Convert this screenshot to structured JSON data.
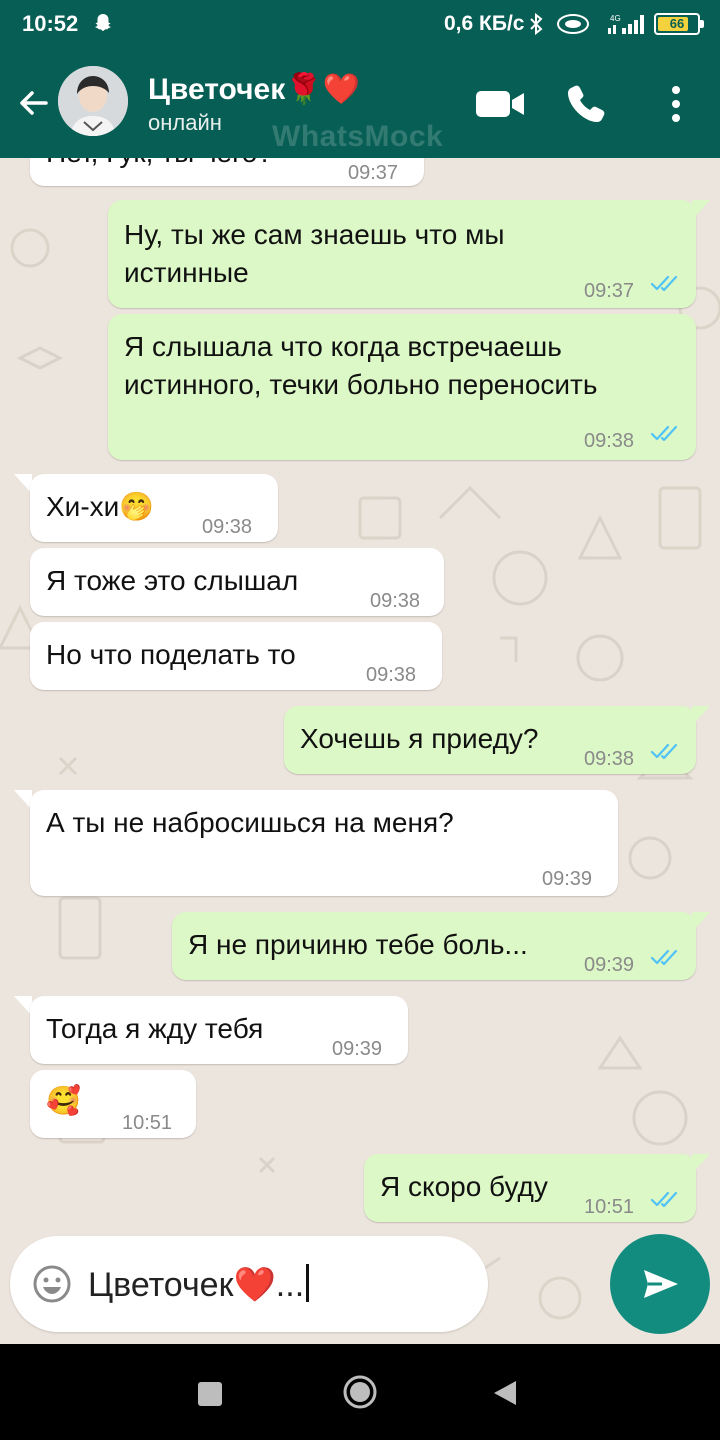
{
  "status_bar": {
    "time": "10:52",
    "net_speed": "0,6 КБ/с",
    "battery": "66"
  },
  "header": {
    "contact_name": "Цветочек🌹❤️",
    "contact_status": "онлайн",
    "watermark": "WhatsMock",
    "colors": {
      "header_bg": "#075e54",
      "out_bubble": "#dcf8c6",
      "in_bubble": "#ffffff",
      "read_ticks": "#4fc3f7"
    }
  },
  "messages": [
    {
      "dir": "in",
      "text": "Нет, Гук, ты чего?",
      "time": "09:37"
    },
    {
      "dir": "out",
      "text": "Ну, ты же сам знаешь что мы\nистинные",
      "time": "09:37"
    },
    {
      "dir": "out",
      "text": "Я слышала что когда встречаешь\nистинного, течки больно переносить",
      "time": "09:38"
    },
    {
      "dir": "in",
      "text": "Хи-хи🤭",
      "time": "09:38"
    },
    {
      "dir": "in",
      "text": "Я тоже это слышал",
      "time": "09:38"
    },
    {
      "dir": "in",
      "text": "Но что поделать то",
      "time": "09:38"
    },
    {
      "dir": "out",
      "text": "Хочешь я приеду?",
      "time": "09:38"
    },
    {
      "dir": "in",
      "text": "А ты не набросишься на меня?",
      "time": "09:39"
    },
    {
      "dir": "out",
      "text": "Я не причиню тебе боль...",
      "time": "09:39"
    },
    {
      "dir": "in",
      "text": "Тогда я жду тебя",
      "time": "09:39"
    },
    {
      "dir": "in",
      "text": "🥰",
      "time": "10:51"
    },
    {
      "dir": "out",
      "text": "Я скоро буду",
      "time": "10:51"
    }
  ],
  "composer": {
    "text": "Цветочек❤️..."
  }
}
